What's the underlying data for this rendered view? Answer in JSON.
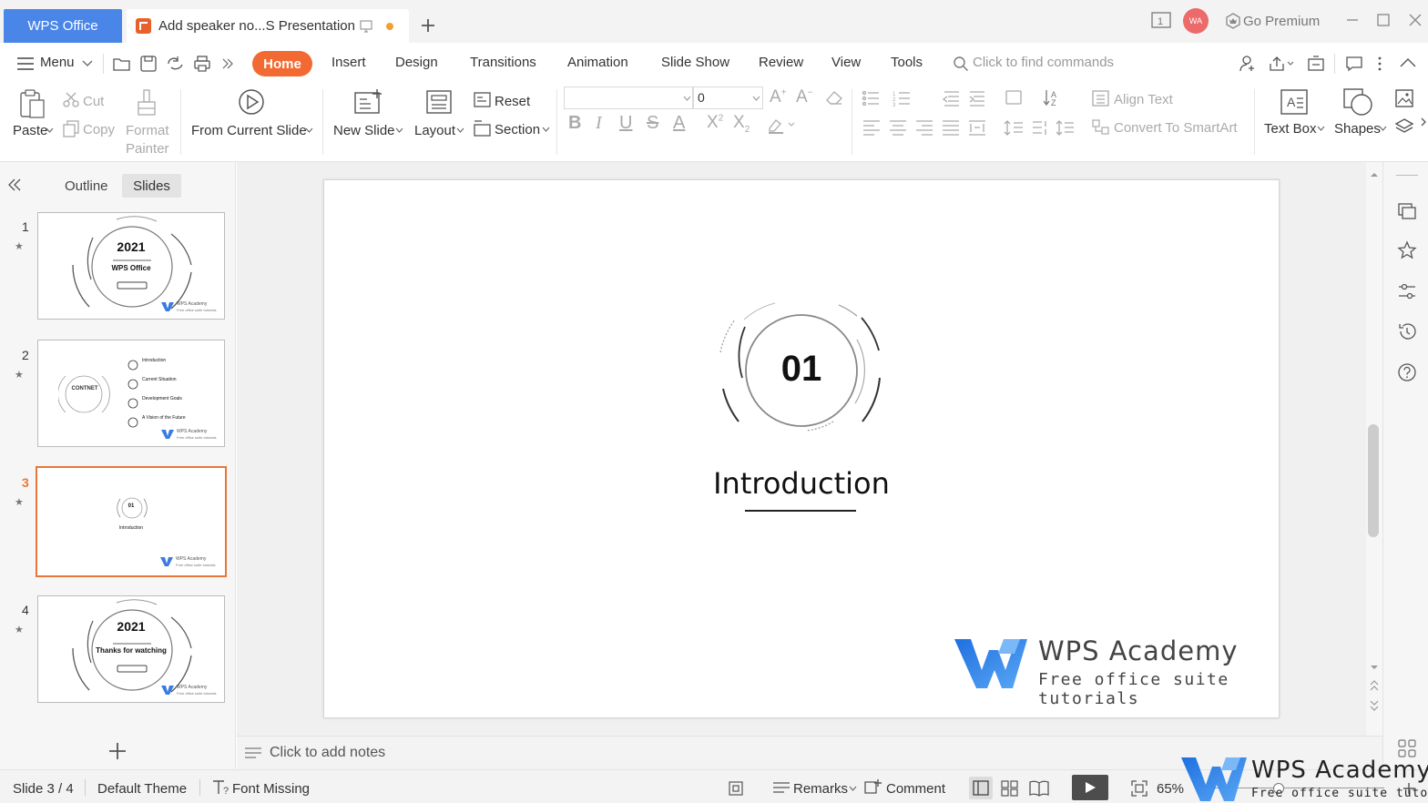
{
  "titlebar": {
    "app_tab": "WPS Office",
    "doc_tab": "Add speaker no...S Presentation",
    "premium": "Go Premium",
    "avatar": "WA"
  },
  "menubar": {
    "menu_label": "Menu",
    "tabs": [
      "Home",
      "Insert",
      "Design",
      "Transitions",
      "Animation",
      "Slide Show",
      "Review",
      "View",
      "Tools"
    ],
    "search_placeholder": "Click to find commands"
  },
  "ribbon": {
    "paste": "Paste",
    "cut": "Cut",
    "copy": "Copy",
    "format_painter_1": "Format",
    "format_painter_2": "Painter",
    "from_current_slide": "From Current Slide",
    "new_slide": "New Slide",
    "layout": "Layout",
    "reset": "Reset",
    "section": "Section",
    "font_size": "0",
    "align_text": "Align Text",
    "convert_smartart": "Convert To SmartArt",
    "text_box": "Text Box",
    "shapes": "Shapes"
  },
  "leftpanel": {
    "outline_tab": "Outline",
    "slides_tab": "Slides",
    "thumbnails": [
      {
        "num": "1",
        "year": "2021",
        "subtitle": "WPS Office",
        "brand": "WPS Academy",
        "tagline": "Free office suite tutorials"
      },
      {
        "num": "2",
        "center": "CONTNET",
        "items": [
          "Introduction",
          "Current Situation",
          "Development Goals",
          "A Vision of the Future"
        ],
        "brand": "WPS Academy",
        "tagline": "Free office suite tutorials"
      },
      {
        "num": "3",
        "number": "01",
        "title": "Introduction",
        "brand": "WPS Academy",
        "tagline": "Free office suite tutorials"
      },
      {
        "num": "4",
        "year": "2021",
        "subtitle": "Thanks for watching",
        "brand": "WPS Academy",
        "tagline": "Free office suite tutorials"
      }
    ]
  },
  "slide": {
    "number": "01",
    "title": "Introduction",
    "brand": "WPS Academy",
    "tagline": "Free office suite tutorials"
  },
  "notes": {
    "placeholder": "Click to add notes"
  },
  "statusbar": {
    "slide_counter": "Slide 3 / 4",
    "theme": "Default Theme",
    "font_missing": "Font Missing",
    "remarks": "Remarks",
    "comment": "Comment",
    "zoom": "65%"
  },
  "watermark": {
    "brand": "WPS Academy",
    "tagline": "Free office suite tutorials"
  },
  "colors": {
    "accent_orange": "#f26a32",
    "wps_blue": "#4a86e8",
    "selected_border": "#e8763a"
  }
}
